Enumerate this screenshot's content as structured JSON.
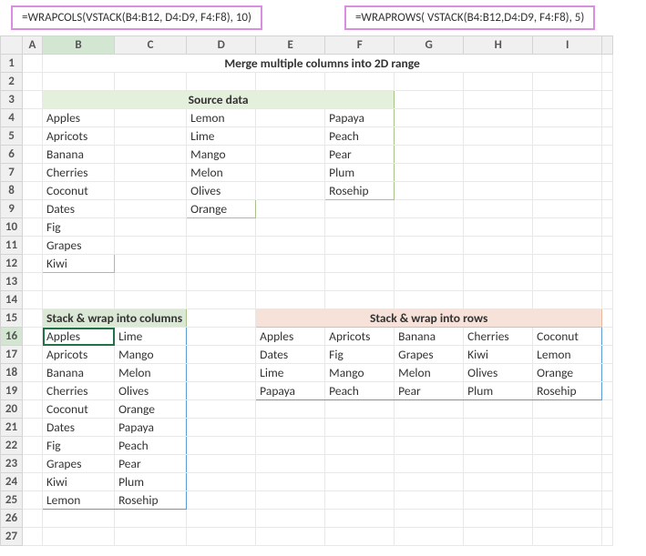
{
  "formulas": {
    "left": "=WRAPCOLS(VSTACK(B4:B12, D4:D9, F4:F8), 10)",
    "right": "=WRAPROWS( VSTACK(B4:B12,D4:D9, F4:F8), 5)"
  },
  "columns": [
    "A",
    "B",
    "C",
    "D",
    "E",
    "F",
    "G",
    "H",
    "I"
  ],
  "title": "Merge multiple columns into 2D range",
  "source": {
    "header": "Source data",
    "colB": [
      "Apples",
      "Apricots",
      "Banana",
      "Cherries",
      "Coconut",
      "Dates",
      "Fig",
      "Grapes",
      "Kiwi"
    ],
    "colD": [
      "Lemon",
      "Lime",
      "Mango",
      "Melon",
      "Olives",
      "Orange"
    ],
    "colF": [
      "Papaya",
      "Peach",
      "Pear",
      "Plum",
      "Rosehip"
    ]
  },
  "section_cols": {
    "header": "Stack & wrap into columns",
    "col1": [
      "Apples",
      "Apricots",
      "Banana",
      "Cherries",
      "Coconut",
      "Dates",
      "Fig",
      "Grapes",
      "Kiwi",
      "Lemon"
    ],
    "col2": [
      "Lime",
      "Mango",
      "Melon",
      "Olives",
      "Orange",
      "Papaya",
      "Peach",
      "Pear",
      "Plum",
      "Rosehip"
    ]
  },
  "section_rows": {
    "header": "Stack & wrap into rows",
    "rows": [
      [
        "Apples",
        "Apricots",
        "Banana",
        "Cherries",
        "Coconut"
      ],
      [
        "Dates",
        "Fig",
        "Grapes",
        "Kiwi",
        "Lemon"
      ],
      [
        "Lime",
        "Mango",
        "Melon",
        "Olives",
        "Orange"
      ],
      [
        "Papaya",
        "Peach",
        "Pear",
        "Plum",
        "Rosehip"
      ]
    ]
  }
}
